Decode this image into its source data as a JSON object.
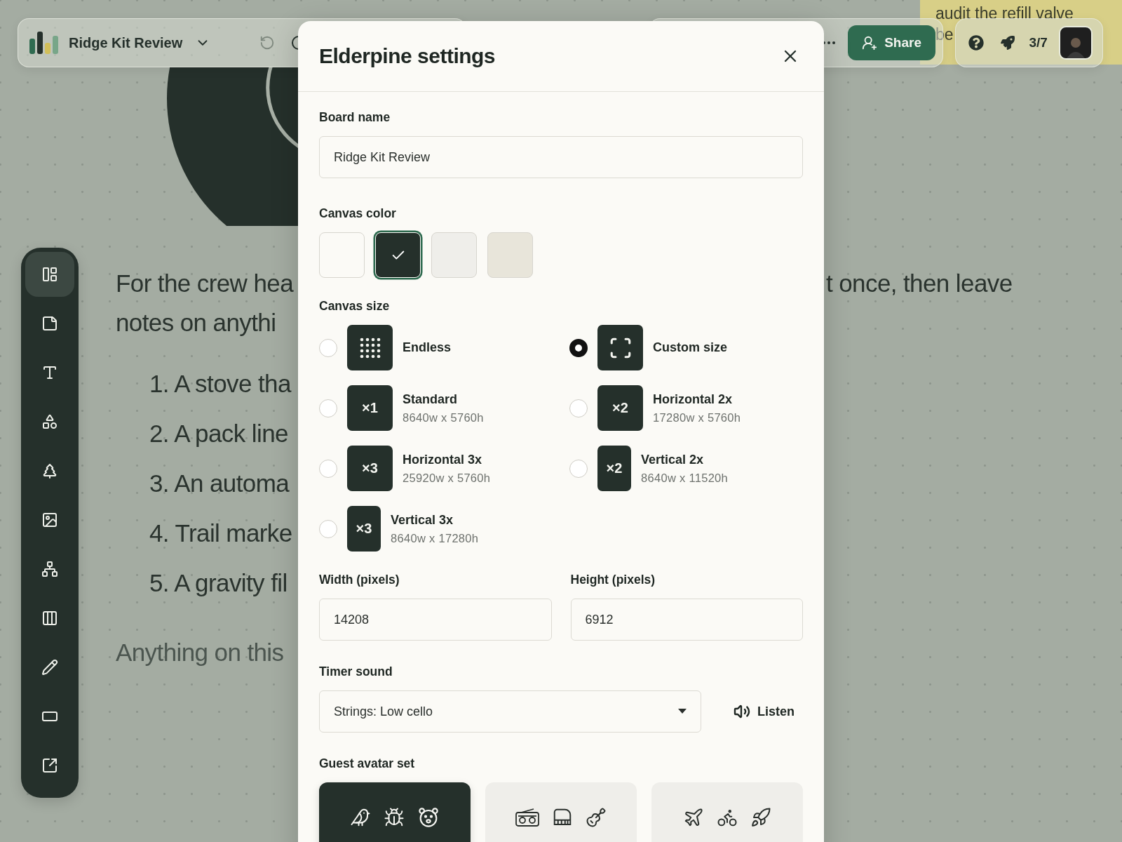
{
  "canvas": {
    "sticky_note": {
      "lines": [
        "audit the refill valve",
        "be"
      ]
    },
    "intro_left": [
      "For the crew hea",
      "notes on anythi"
    ],
    "intro_right": "t once, then leave",
    "list": [
      "1. A stove tha",
      "2. A pack line",
      "3. An automa",
      "4. Trail marke",
      "5. A gravity fil"
    ],
    "outro": "Anything on this"
  },
  "toolbar": {
    "title": "Ridge Kit Review",
    "share": "Share",
    "progress": "3/7"
  },
  "sidebar": {
    "items": [
      {
        "selected": true
      },
      {
        "selected": false
      },
      {
        "selected": false
      },
      {
        "selected": false
      },
      {
        "selected": false
      },
      {
        "selected": false
      },
      {
        "selected": false
      },
      {
        "selected": false
      },
      {
        "selected": false
      },
      {
        "selected": false
      },
      {
        "selected": false
      }
    ]
  },
  "dialog": {
    "title": "Elderpine settings",
    "board_name": {
      "label": "Board name",
      "value": "Ridge Kit Review"
    },
    "canvas_color": {
      "label": "Canvas color",
      "swatches": [
        {
          "color": "#fbfaf6",
          "selected": false
        },
        {
          "color": "#25302b",
          "selected": true
        },
        {
          "color": "#efeeea",
          "selected": false
        },
        {
          "color": "#e8e5da",
          "selected": false
        }
      ]
    },
    "canvas_size": {
      "label": "Canvas size",
      "options": [
        {
          "kind": "grid",
          "label": "Endless",
          "selected": false
        },
        {
          "kind": "frame",
          "label": "Custom size",
          "selected": true
        },
        {
          "kind": "multiplier",
          "badge": "×1",
          "tall": false,
          "label": "Standard",
          "detail": "8640w x 5760h",
          "selected": false
        },
        {
          "kind": "multiplier",
          "badge": "×2",
          "tall": false,
          "label": "Horizontal 2x",
          "detail": "17280w x 5760h",
          "selected": false
        },
        {
          "kind": "multiplier",
          "badge": "×3",
          "tall": false,
          "label": "Horizontal 3x",
          "detail": "25920w x 5760h",
          "selected": false
        },
        {
          "kind": "multiplier",
          "badge": "×2",
          "tall": true,
          "label": "Vertical 2x",
          "detail": "8640w x 11520h",
          "selected": false
        },
        {
          "kind": "multiplier",
          "badge": "×3",
          "tall": true,
          "label": "Vertical 3x",
          "detail": "8640w x 17280h",
          "selected": false
        }
      ]
    },
    "width": {
      "label": "Width (pixels)",
      "value": "14208"
    },
    "height": {
      "label": "Height (pixels)",
      "value": "6912"
    },
    "timer_sound": {
      "label": "Timer sound",
      "value": "Strings: Low cello",
      "listen": "Listen"
    },
    "avatar_set": {
      "label": "Guest avatar set",
      "sets": [
        {
          "selected": true
        },
        {
          "selected": false
        },
        {
          "selected": false
        }
      ]
    }
  }
}
